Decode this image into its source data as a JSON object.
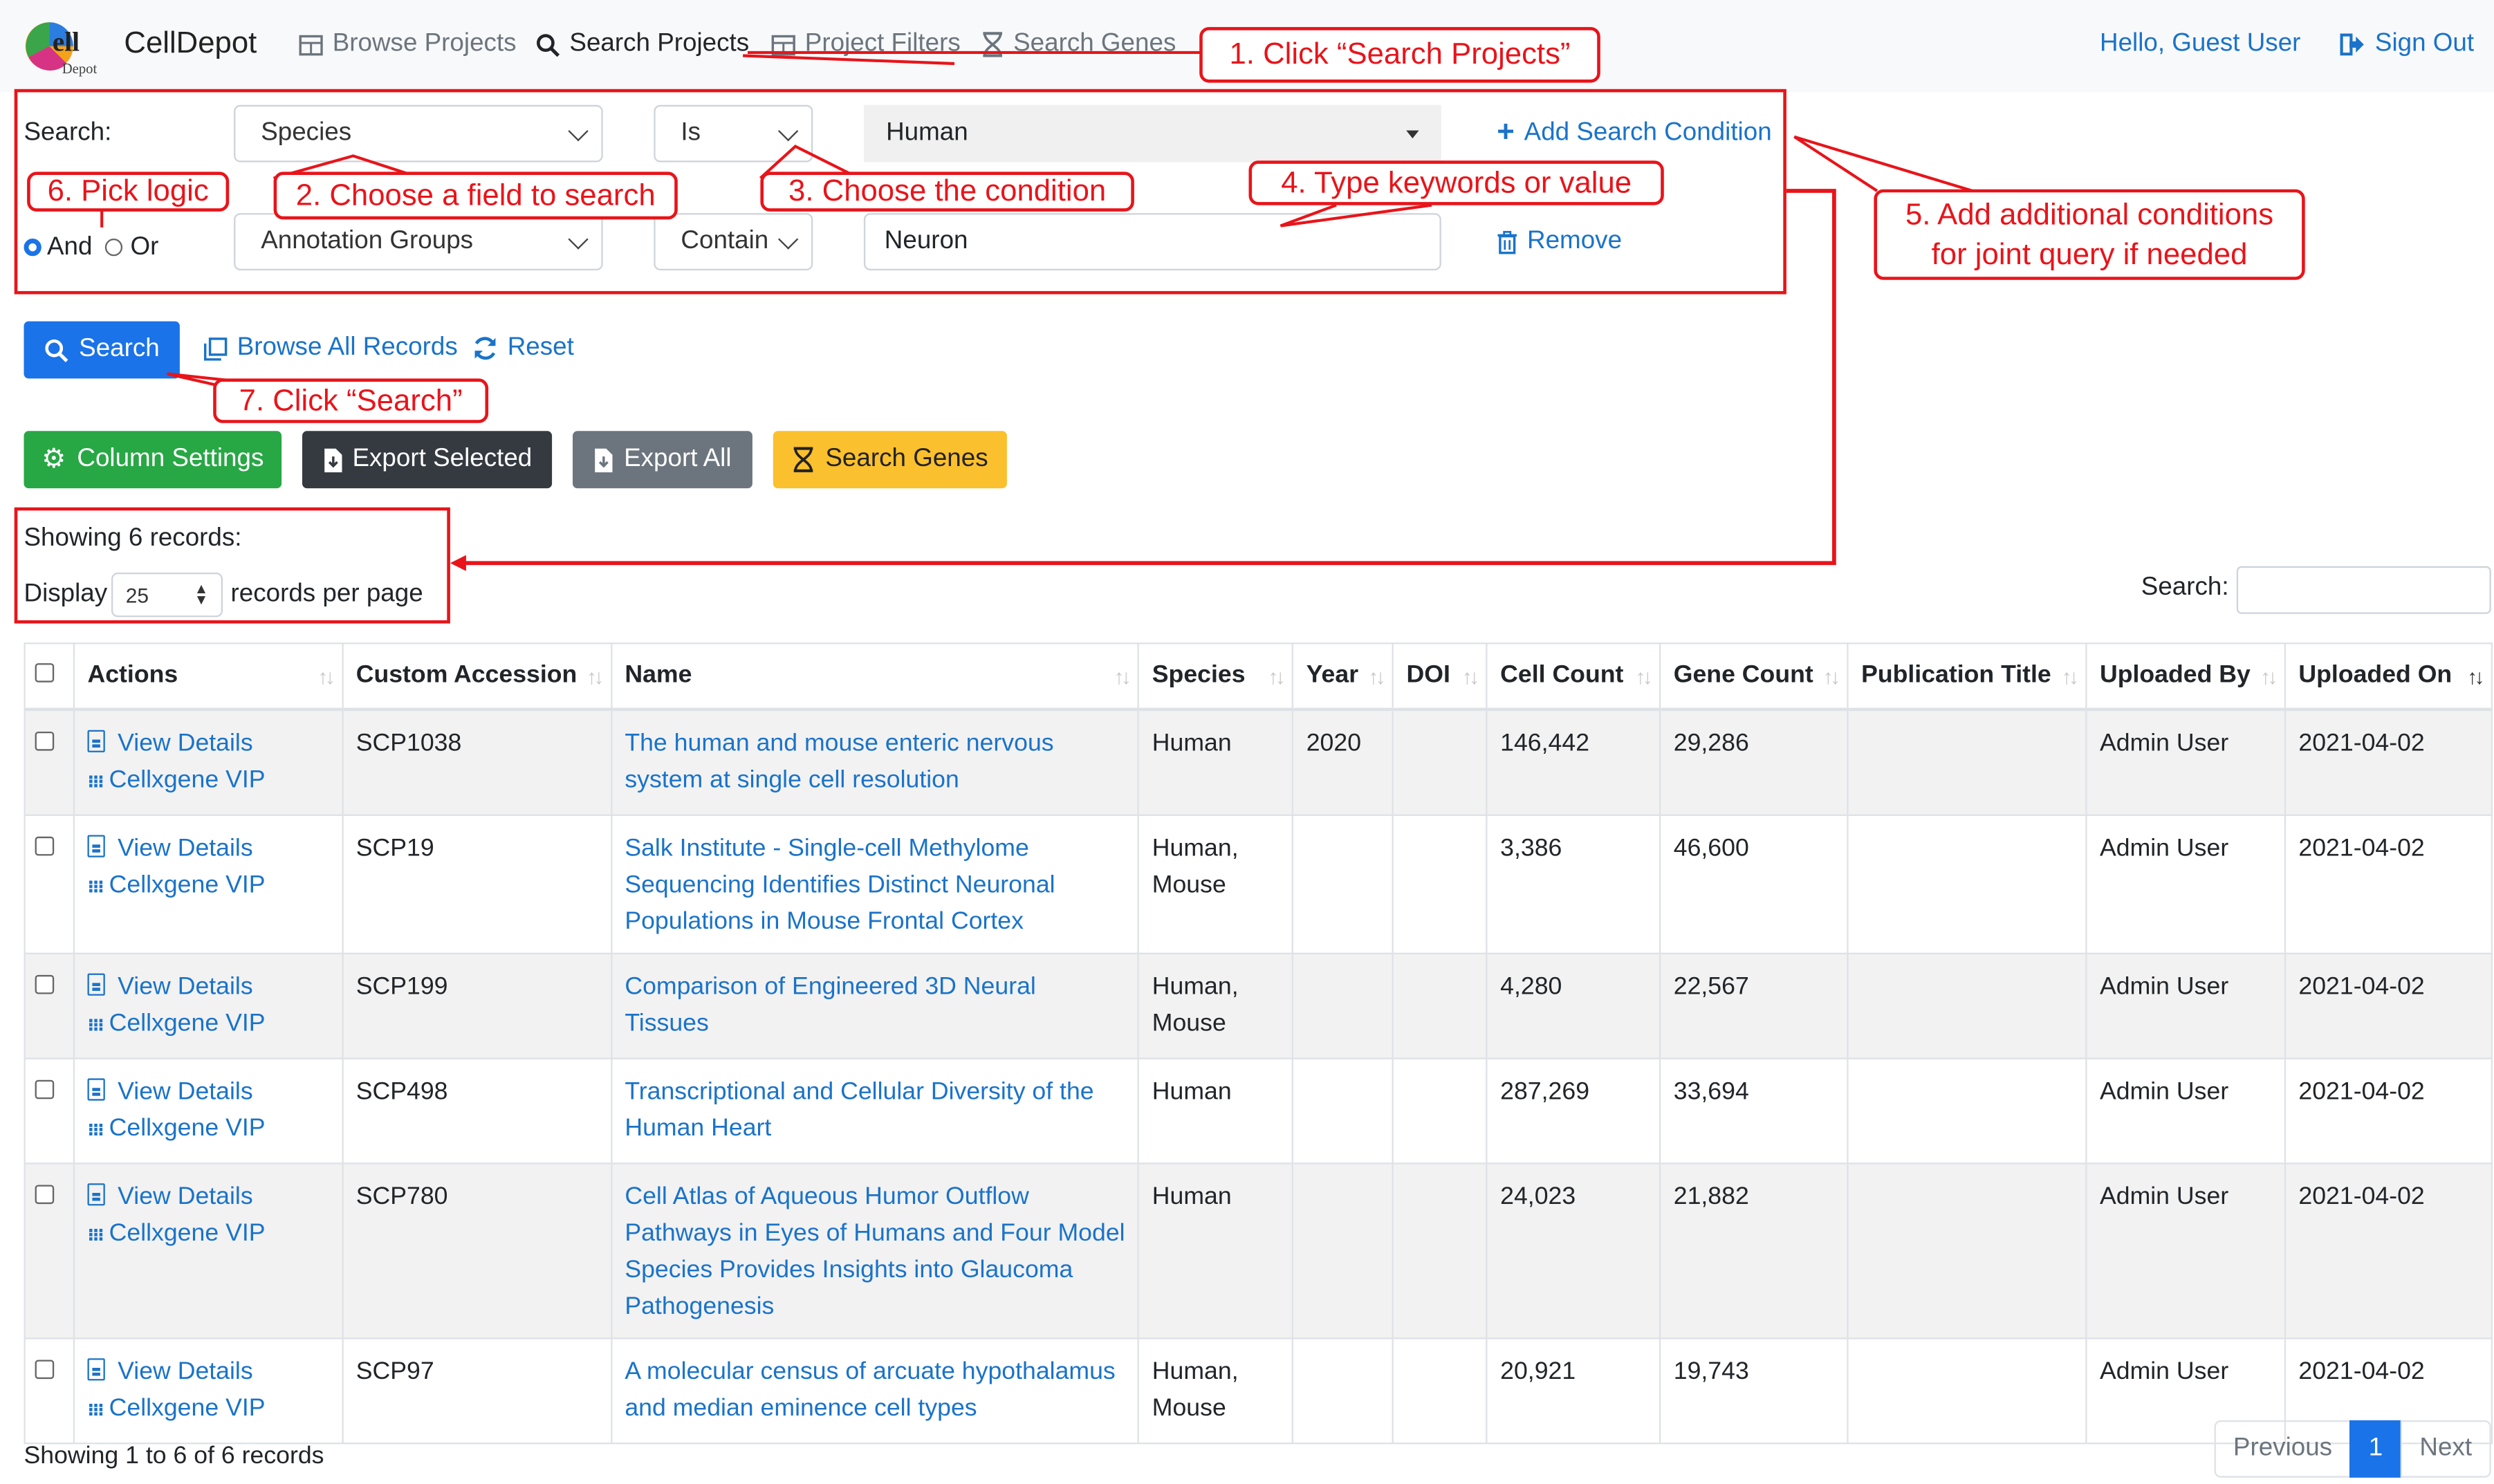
{
  "nav": {
    "brand": "CellDepot",
    "items": [
      {
        "label": "Browse Projects",
        "icon": "table-icon"
      },
      {
        "label": "Search Projects",
        "icon": "search-icon"
      },
      {
        "label": "Project Filters",
        "icon": "table-icon"
      },
      {
        "label": "Search Genes",
        "icon": "dna-icon"
      }
    ],
    "greeting": "Hello, Guest User",
    "sign_out": "Sign Out"
  },
  "search_form": {
    "label": "Search:",
    "row1": {
      "field": "Species",
      "condition": "Is",
      "value": "Human"
    },
    "add_condition": "Add Search Condition",
    "logic": {
      "and": "And",
      "or": "Or",
      "selected": "And"
    },
    "row2": {
      "field": "Annotation Groups",
      "condition": "Contain",
      "value": "Neuron"
    },
    "remove": "Remove"
  },
  "actions": {
    "search": "Search",
    "browse_all": "Browse All Records",
    "reset": "Reset",
    "column_settings": "Column Settings",
    "export_selected": "Export Selected",
    "export_all": "Export All",
    "search_genes": "Search Genes"
  },
  "summary": {
    "showing": "Showing 6 records:",
    "display": "Display",
    "per_page": "25",
    "records_per_page": "records per page",
    "table_search_label": "Search:",
    "footer": "Showing 1 to 6 of 6 records"
  },
  "table": {
    "columns": [
      "Actions",
      "Custom Accession",
      "Name",
      "Species",
      "Year",
      "DOI",
      "Cell Count",
      "Gene Count",
      "Publication Title",
      "Uploaded By",
      "Uploaded On"
    ],
    "view_details": "View Details",
    "cellxgene": "Cellxgene VIP",
    "rows": [
      {
        "accession": "SCP1038",
        "name": "The human and mouse enteric nervous system at single cell resolution",
        "species": "Human",
        "year": "2020",
        "doi": "",
        "cell_count": "146,442",
        "gene_count": "29,286",
        "pub_title": "",
        "uploaded_by": "Admin User",
        "uploaded_on": "2021-04-02"
      },
      {
        "accession": "SCP19",
        "name": "Salk Institute - Single-cell Methylome Sequencing Identifies Distinct Neuronal Populations in Mouse Frontal Cortex",
        "species": "Human, Mouse",
        "year": "",
        "doi": "",
        "cell_count": "3,386",
        "gene_count": "46,600",
        "pub_title": "",
        "uploaded_by": "Admin User",
        "uploaded_on": "2021-04-02"
      },
      {
        "accession": "SCP199",
        "name": "Comparison of Engineered 3D Neural Tissues",
        "species": "Human, Mouse",
        "year": "",
        "doi": "",
        "cell_count": "4,280",
        "gene_count": "22,567",
        "pub_title": "",
        "uploaded_by": "Admin User",
        "uploaded_on": "2021-04-02"
      },
      {
        "accession": "SCP498",
        "name": "Transcriptional and Cellular Diversity of the Human Heart",
        "species": "Human",
        "year": "",
        "doi": "",
        "cell_count": "287,269",
        "gene_count": "33,694",
        "pub_title": "",
        "uploaded_by": "Admin User",
        "uploaded_on": "2021-04-02"
      },
      {
        "accession": "SCP780",
        "name": "Cell Atlas of Aqueous Humor Outflow Pathways in Eyes of Humans and Four Model Species Provides Insights into Glaucoma Pathogenesis",
        "species": "Human",
        "year": "",
        "doi": "",
        "cell_count": "24,023",
        "gene_count": "21,882",
        "pub_title": "",
        "uploaded_by": "Admin User",
        "uploaded_on": "2021-04-02"
      },
      {
        "accession": "SCP97",
        "name": "A molecular census of arcuate hypothalamus and median eminence cell types",
        "species": "Human, Mouse",
        "year": "",
        "doi": "",
        "cell_count": "20,921",
        "gene_count": "19,743",
        "pub_title": "",
        "uploaded_by": "Admin User",
        "uploaded_on": "2021-04-02"
      }
    ]
  },
  "pagination": {
    "previous": "Previous",
    "current": "1",
    "next": "Next"
  },
  "annotations": {
    "step1": "1. Click “Search Projects”",
    "step2": "2. Choose a field to search",
    "step3": "3. Choose the condition",
    "step4": "4. Type keywords or value",
    "step5_line1": "5. Add additional conditions",
    "step5_line2": "for joint query if needed",
    "step6": "6. Pick logic",
    "step7": "7. Click “Search”"
  },
  "colors": {
    "annotation_red": "#e8141a",
    "link_blue": "#1a73c9",
    "primary": "#1a73e8"
  }
}
